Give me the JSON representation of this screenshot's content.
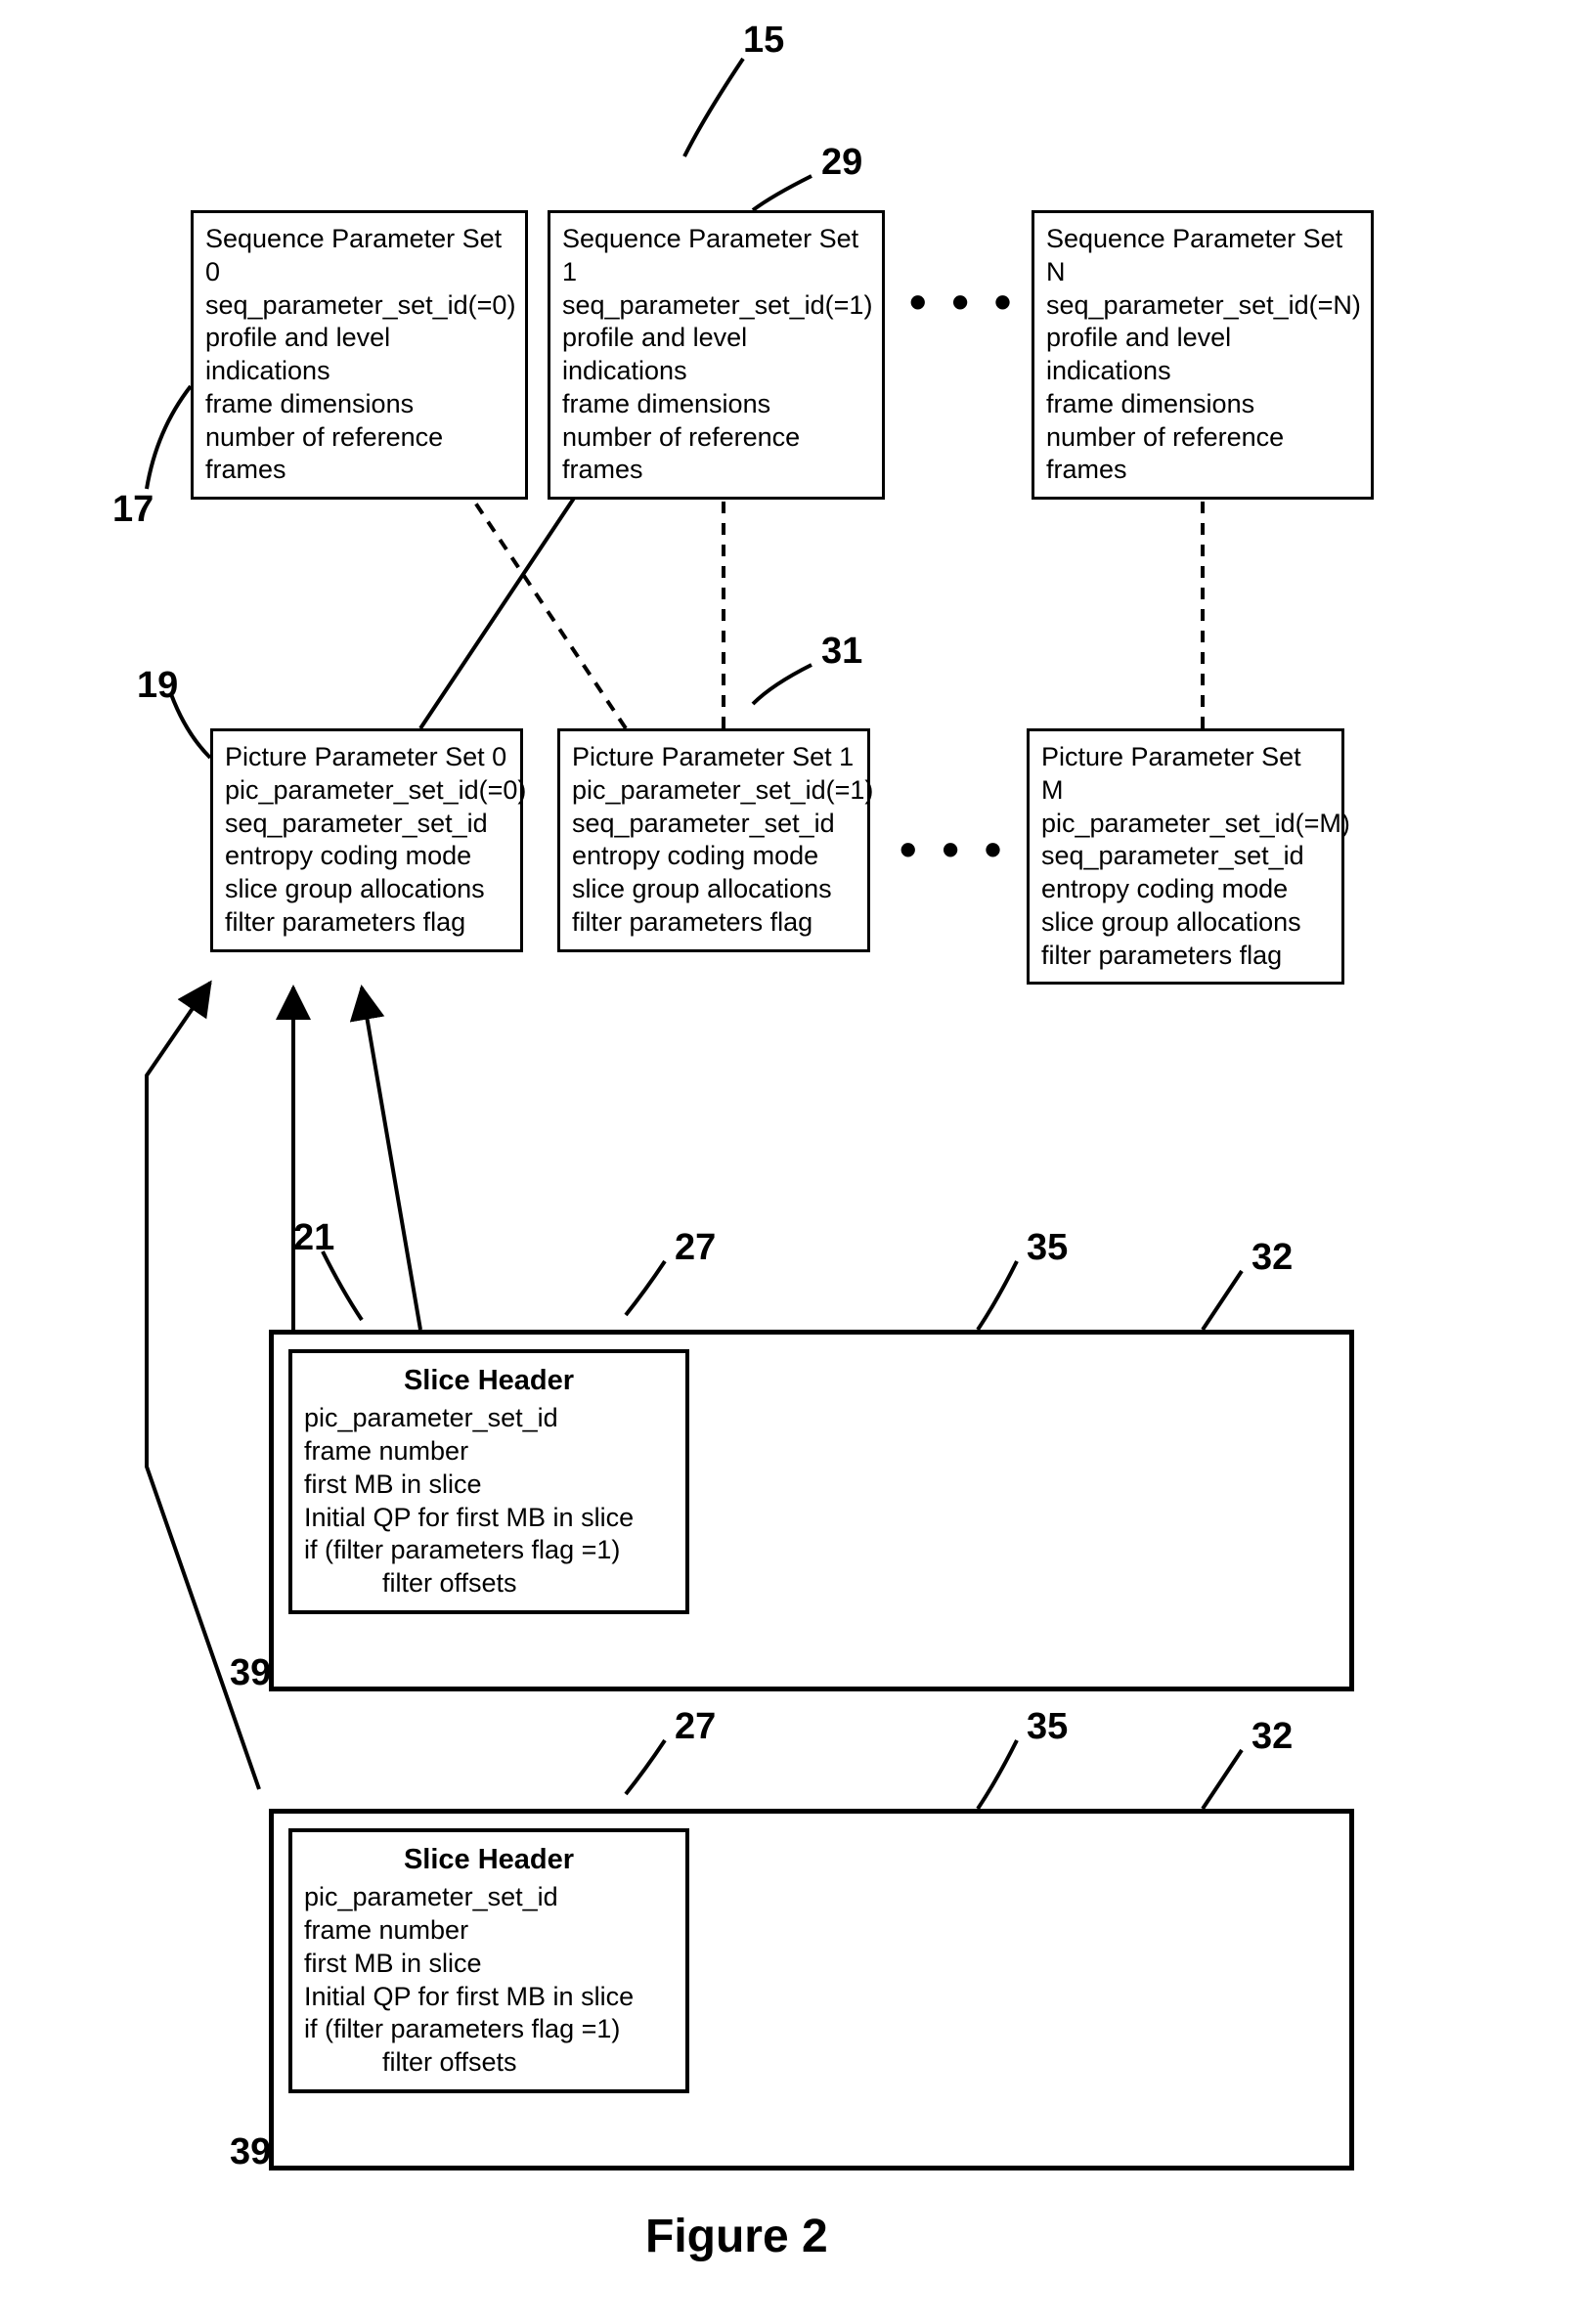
{
  "figure_label": "Figure 2",
  "labels": {
    "l15": "15",
    "l17": "17",
    "l19": "19",
    "l21": "21",
    "l27a": "27",
    "l27b": "27",
    "l29": "29",
    "l31": "31",
    "l32a": "32",
    "l32b": "32",
    "l35a": "35",
    "l35b": "35",
    "l39a": "39",
    "l39b": "39"
  },
  "ellipsis1": "• • •",
  "ellipsis2": "• • •",
  "sps0": {
    "t1": "Sequence Parameter Set 0",
    "t2": "seq_parameter_set_id(=0)",
    "t3": "profile and level indications",
    "t4": "frame dimensions",
    "t5": "number of reference frames"
  },
  "sps1": {
    "t1": "Sequence Parameter Set 1",
    "t2": "seq_parameter_set_id(=1)",
    "t3": "profile and level indications",
    "t4": "frame dimensions",
    "t5": "number of reference frames"
  },
  "spsN": {
    "t1": "Sequence Parameter Set N",
    "t2": "seq_parameter_set_id(=N)",
    "t3": "profile and level indications",
    "t4": "frame dimensions",
    "t5": "number of reference frames"
  },
  "pps0": {
    "t1": "Picture Parameter Set 0",
    "t2": "pic_parameter_set_id(=0)",
    "t3": "seq_parameter_set_id",
    "t4": "entropy coding mode",
    "t5": "slice group allocations",
    "t6": "filter parameters flag"
  },
  "pps1": {
    "t1": "Picture Parameter Set 1",
    "t2": "pic_parameter_set_id(=1)",
    "t3": "seq_parameter_set_id",
    "t4": "entropy coding mode",
    "t5": "slice group allocations",
    "t6": "filter parameters flag"
  },
  "ppsM": {
    "t1": "Picture Parameter Set M",
    "t2": "pic_parameter_set_id(=M)",
    "t3": "seq_parameter_set_id",
    "t4": "entropy coding mode",
    "t5": "slice group allocations",
    "t6": "filter parameters flag"
  },
  "slice": {
    "title": "Slice Header",
    "t1": "pic_parameter_set_id",
    "t2": "frame number",
    "t3": "first MB in slice",
    "t4": "Initial QP for first MB in slice",
    "t5": "if (filter parameters flag =1)",
    "t6": "filter offsets"
  }
}
